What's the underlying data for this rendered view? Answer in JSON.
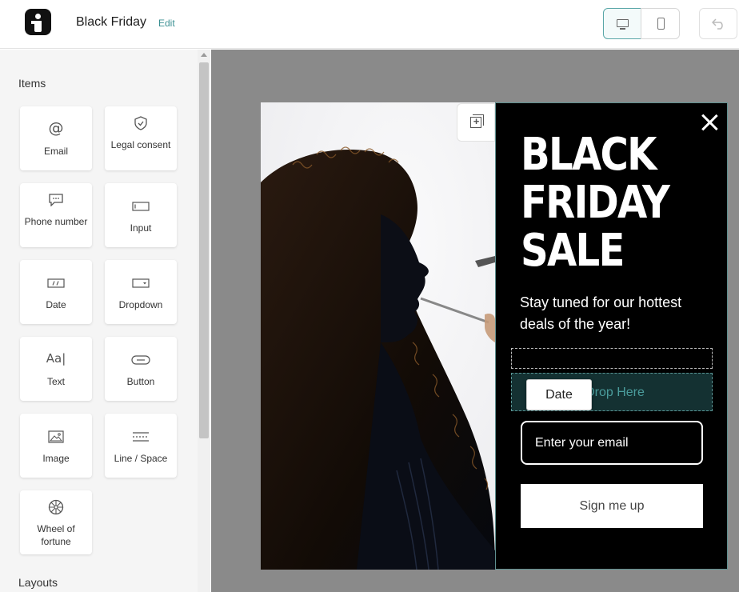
{
  "header": {
    "title": "Black Friday",
    "edit_label": "Edit",
    "device_desktop_icon": "monitor-icon",
    "device_mobile_icon": "phone-icon",
    "undo_icon": "undo-icon"
  },
  "sidebar": {
    "items_heading": "Items",
    "layouts_heading": "Layouts",
    "items": [
      {
        "label": "Email",
        "icon": "at-icon"
      },
      {
        "label": "Legal consent",
        "icon": "shield-icon"
      },
      {
        "label": "Phone number",
        "icon": "chat-icon"
      },
      {
        "label": "Input",
        "icon": "input-icon"
      },
      {
        "label": "Date",
        "icon": "date-icon"
      },
      {
        "label": "Dropdown",
        "icon": "dropdown-icon"
      },
      {
        "label": "Text",
        "icon": "text-icon"
      },
      {
        "label": "Button",
        "icon": "button-icon"
      },
      {
        "label": "Image",
        "icon": "image-icon"
      },
      {
        "label": "Line / Space",
        "icon": "line-space-icon"
      },
      {
        "label": "Wheel of fortune",
        "icon": "wheel-icon"
      }
    ]
  },
  "popup": {
    "headline": [
      "BLACK",
      "FRIDAY",
      "SALE"
    ],
    "subtext": "Stay tuned for our hottest deals of the year!",
    "drop_text": "Drop Here",
    "drag_chip": "Date",
    "email_placeholder": "Enter your email",
    "signup_label": "Sign me up",
    "accent_color": "#3a8f92"
  }
}
